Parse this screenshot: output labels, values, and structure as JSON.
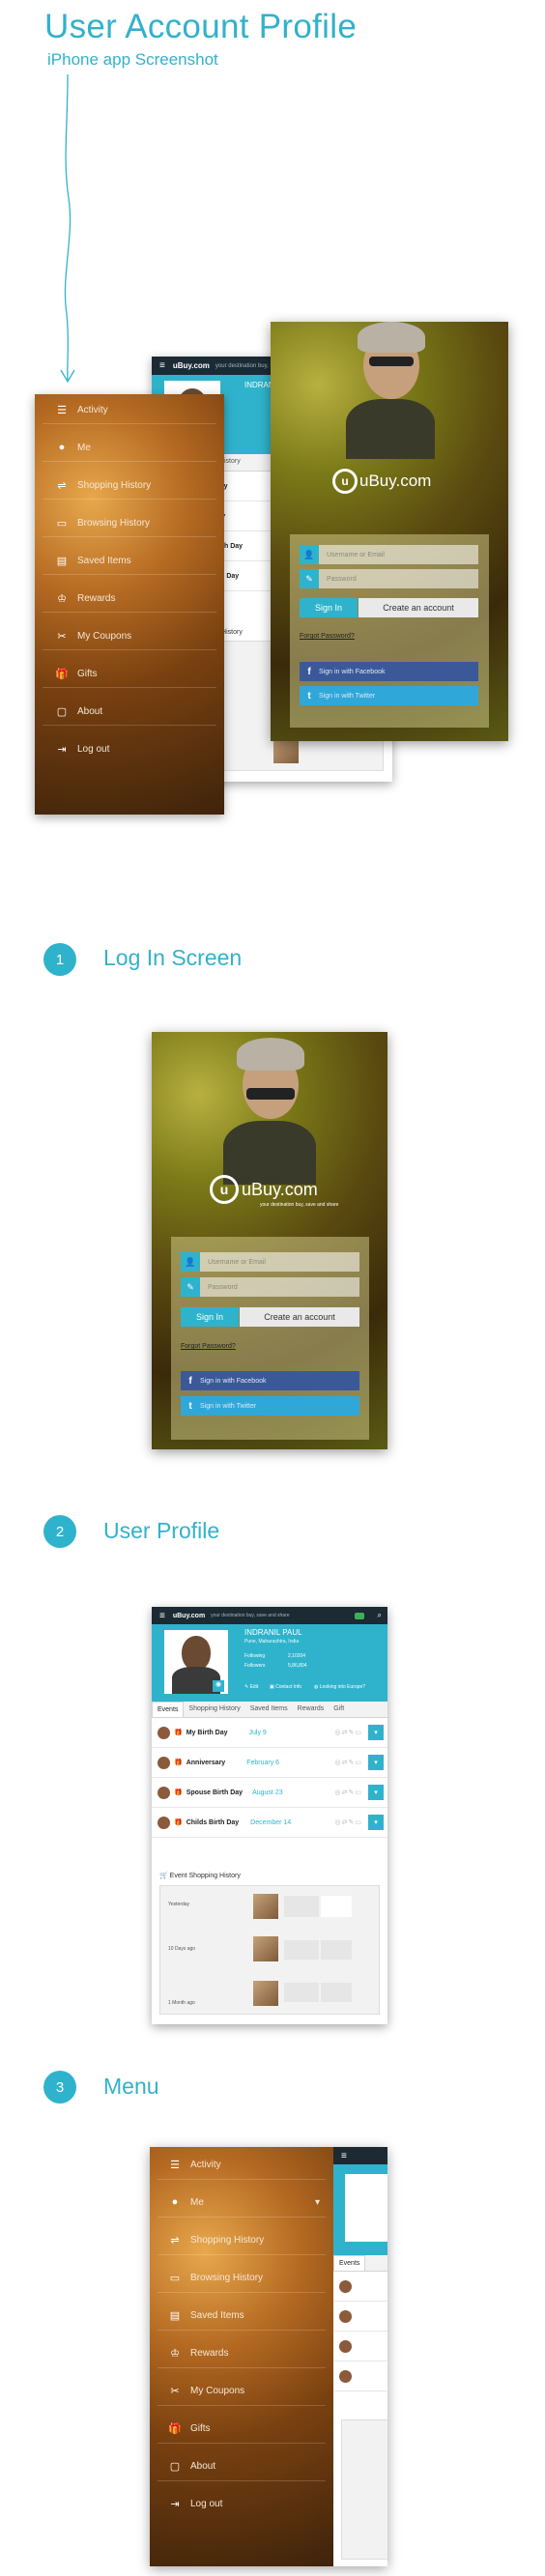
{
  "header": {
    "title": "User Account Profile",
    "subtitle": "iPhone app Screenshot"
  },
  "colors": {
    "accent": "#2fb3cc",
    "dark_bar": "#1c2a33",
    "facebook": "#3b5998",
    "twitter": "#2fa8d9"
  },
  "menu": {
    "items": [
      {
        "icon": "activity-icon",
        "label": "Activity"
      },
      {
        "icon": "user-icon",
        "label": "Me"
      },
      {
        "icon": "shopping-icon",
        "label": "Shopping History"
      },
      {
        "icon": "browse-icon",
        "label": "Browsing History"
      },
      {
        "icon": "saved-icon",
        "label": "Saved Items"
      },
      {
        "icon": "rewards-icon",
        "label": "Rewards"
      },
      {
        "icon": "coupons-icon",
        "label": "My Coupons"
      },
      {
        "icon": "gift-icon",
        "label": "Gifts"
      },
      {
        "icon": "about-icon",
        "label": "About"
      },
      {
        "icon": "logout-icon",
        "label": "Log out"
      }
    ]
  },
  "app": {
    "brand": "uBuy.com",
    "tagline": "your destination buy, save and share"
  },
  "login": {
    "username_placeholder": "Username or Email",
    "password_placeholder": "Password",
    "sign_in": "Sign In",
    "create_account": "Create an account",
    "forgot": "Forgot Password?",
    "facebook": "Sign in with Facebook",
    "twitter": "Sign in with Twitter"
  },
  "profile": {
    "name": "INDRANIL PAUL",
    "location": "Pune, Maharashtra, India",
    "following_label": "Following",
    "following_value": "2,10204",
    "followers_label": "Followers",
    "followers_value": "5,86,804",
    "edit": "Edit",
    "contact_info": "Contact Info",
    "looking": "Looking into Europe?",
    "tabs": [
      "Events",
      "Shopping History",
      "Saved Items",
      "Rewards",
      "Gift"
    ],
    "events": [
      {
        "name": "My Birth Day",
        "date": "July 9"
      },
      {
        "name": "Anniversary",
        "date": "February 6"
      },
      {
        "name": "Spouse Birth Day",
        "date": "August 23"
      },
      {
        "name": "Childs Birth Day",
        "date": "December 14"
      }
    ],
    "history_title": "Event Shopping History",
    "history_groups": [
      "Yesterday",
      "10 Days ago",
      "1 Month ago"
    ]
  },
  "sections": [
    {
      "number": "1",
      "title": "Log In Screen"
    },
    {
      "number": "2",
      "title": "User Profile"
    },
    {
      "number": "3",
      "title": "Menu"
    }
  ]
}
